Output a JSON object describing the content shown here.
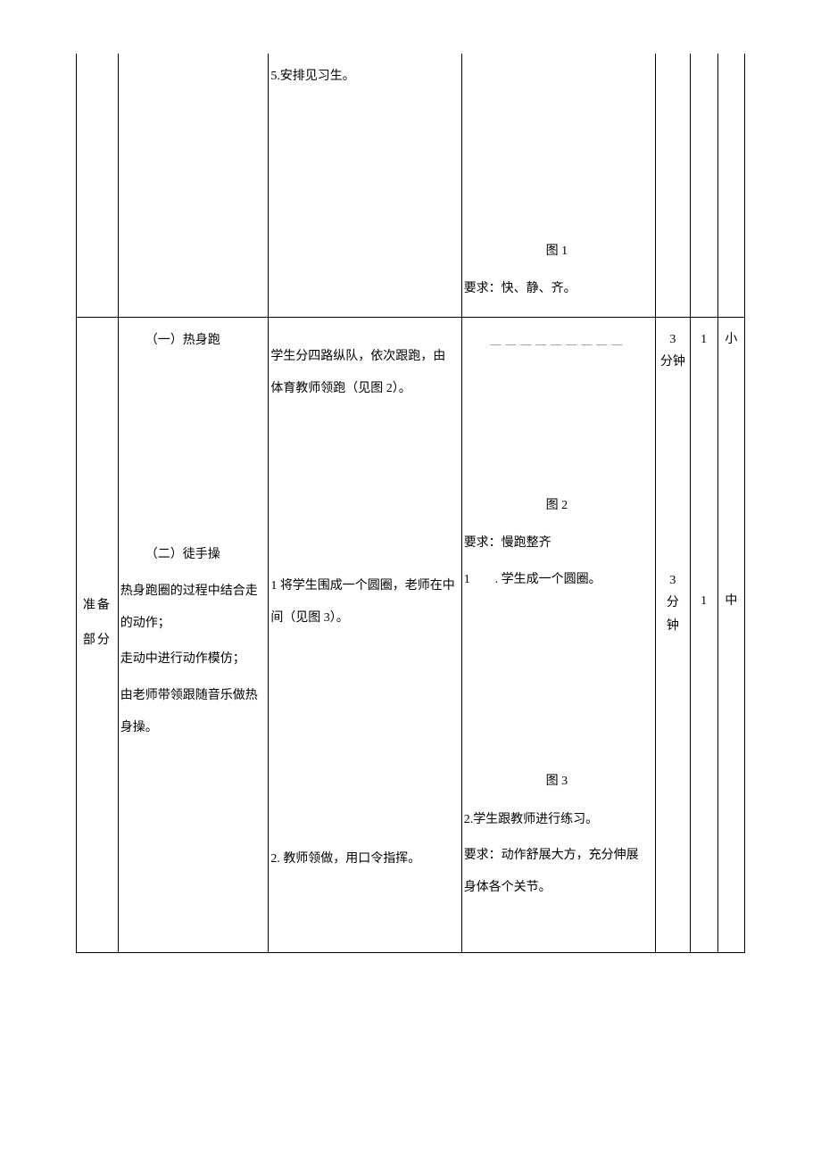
{
  "row1": {
    "teacher": "5.安排见习生。",
    "student": {
      "fig": "图 1",
      "req": "要求：快、静、齐。"
    }
  },
  "row2": {
    "section": {
      "a": "准备",
      "b": "部分"
    },
    "content": {
      "h1": "（一）热身跑",
      "h2": "（二）徒手操",
      "p1": "热身跑圈的过程中结合走的动作；",
      "p2": "走动中进行动作模仿；",
      "p3": "由老师带领跟随音乐做热身操。"
    },
    "teacher": {
      "t1": "学生分四路纵队，依次跟跑，由体育教师领跑（见图 2）。",
      "t2": "1 将学生围成一个圆圈，老师在中间（见图 3）。",
      "t3": "2. 教师领做，用口令指挥。"
    },
    "student": {
      "fig2": "图 2",
      "req1": "要求：慢跑整齐",
      "p1": "1　　. 学生成一个圆圈。",
      "fig3": "图 3",
      "p2": "2.学生跟教师进行练习。",
      "req2": "要求：动作舒展大方，充分伸展身体各个关节。"
    },
    "time": {
      "a": "3",
      "aUnit": "分钟",
      "b": "3",
      "bUnit1": "分",
      "bUnit2": "钟"
    },
    "count": {
      "a": "1",
      "b": "1"
    },
    "intensity": {
      "a": "小",
      "b": "中"
    }
  }
}
